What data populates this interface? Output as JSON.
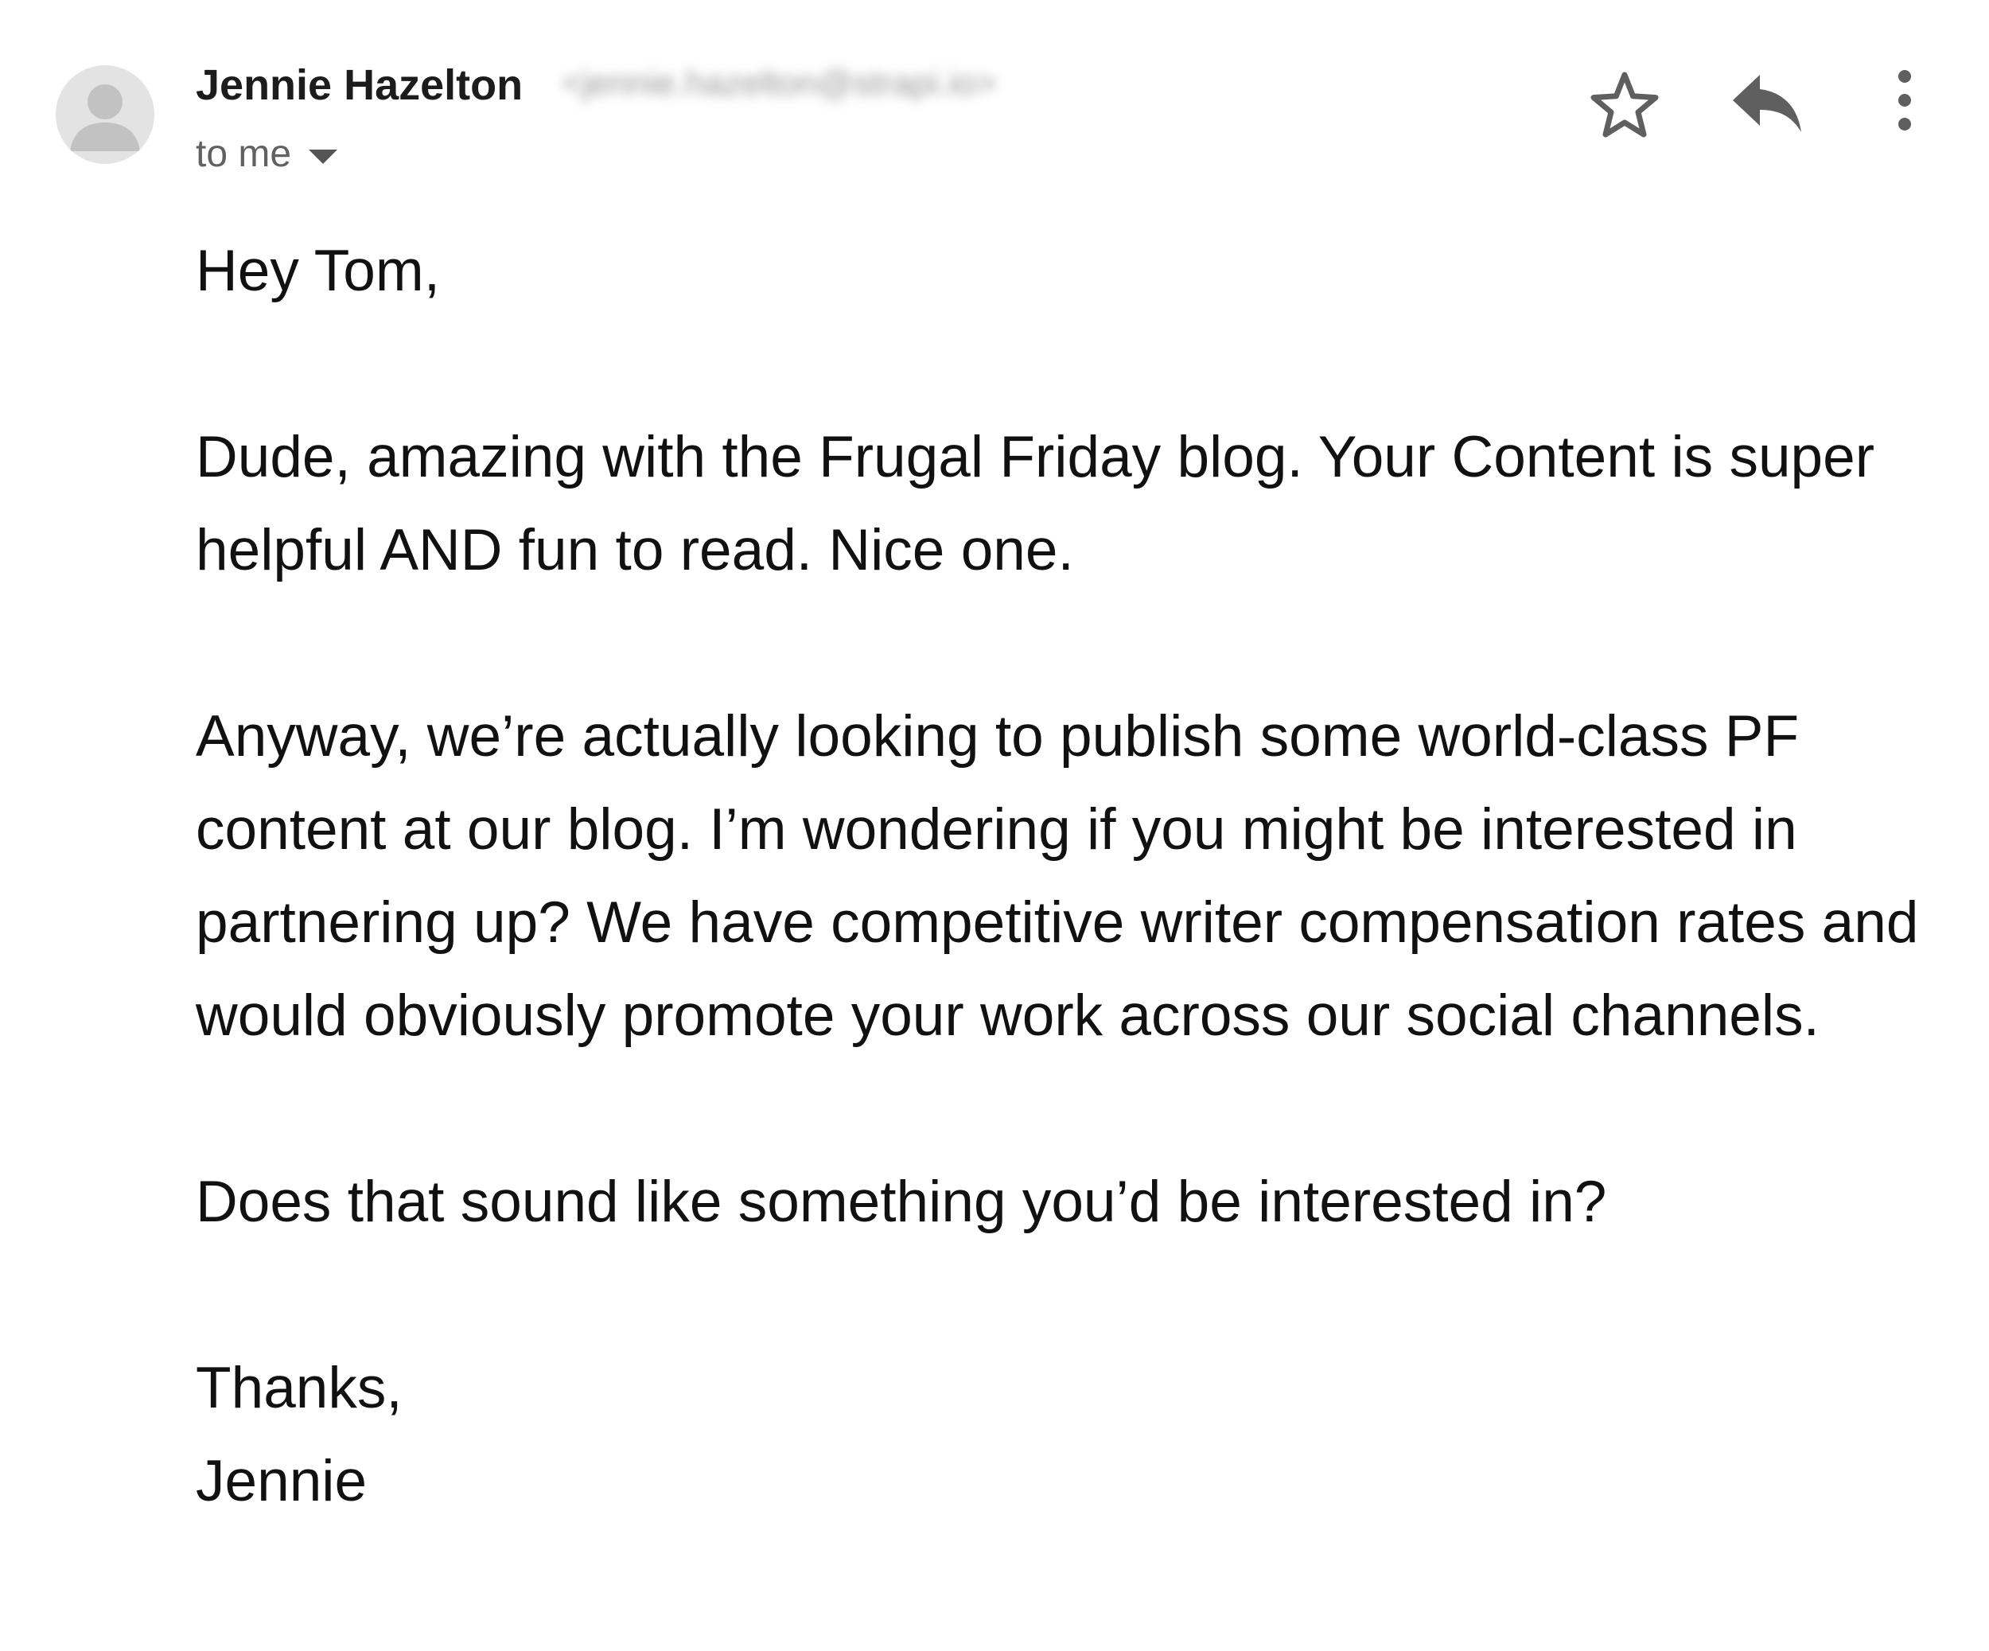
{
  "header": {
    "sender_name": "Jennie Hazelton",
    "sender_email": "<jennie.hazelton@strapi.io>",
    "recipient_label": "to me"
  },
  "icons": {
    "avatar": "person-avatar-icon",
    "star": "star-outline-icon",
    "reply": "reply-icon",
    "more": "more-vertical-icon",
    "dropdown": "caret-down-icon"
  },
  "colors": {
    "avatar_bg": "#e3e3e3",
    "avatar_fg": "#c2c2c2",
    "icon": "#5f5f5f",
    "secondary_text": "#616161"
  },
  "message": {
    "greeting": "Hey Tom,",
    "paragraph_1": "Dude, amazing with the Frugal Friday blog. Your Content is super helpful AND fun to read. Nice one.",
    "paragraph_2": "Anyway, we’re actually looking to publish some world-class PF content at our blog. I’m wondering if you might be interested in partnering up? We have competitive writer compensation rates and would obviously promote your work across our social channels.",
    "paragraph_3": "Does that sound like something you’d be interested in?",
    "signoff": "Thanks,",
    "signature": "Jennie"
  }
}
